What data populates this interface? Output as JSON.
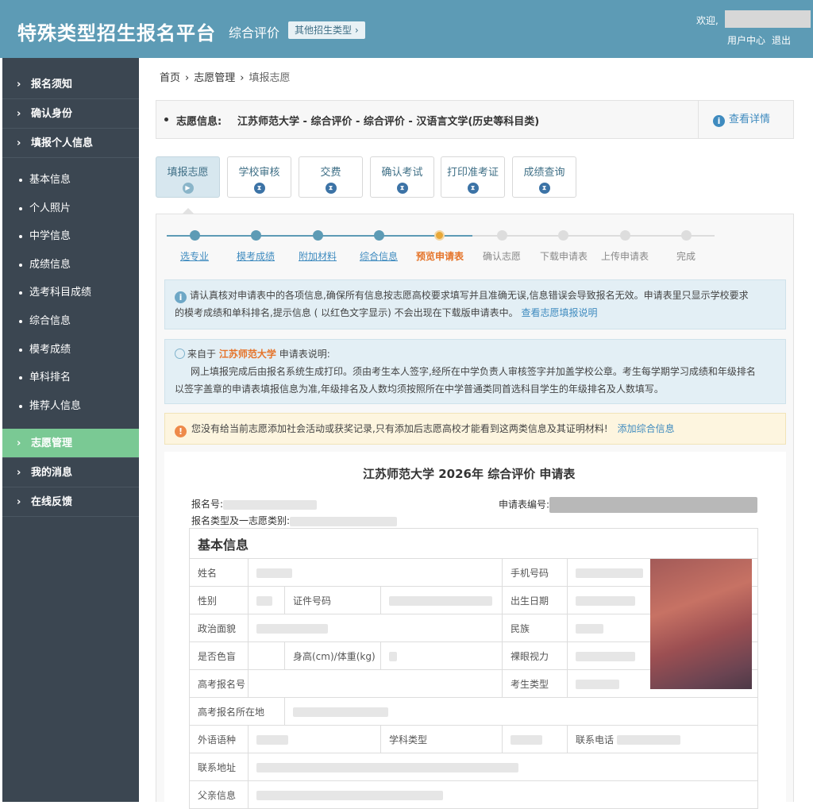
{
  "header": {
    "brand": "特殊类型招生报名平台",
    "sub_brand": "综合评价",
    "other_type_button": "其他招生类型 ›",
    "welcome": "欢迎,",
    "user_center": "用户中心",
    "logout": "退出"
  },
  "sidebar": {
    "items": [
      {
        "label": "报名须知"
      },
      {
        "label": "确认身份"
      },
      {
        "label": "填报个人信息"
      }
    ],
    "sub_items": [
      {
        "label": "基本信息"
      },
      {
        "label": "个人照片"
      },
      {
        "label": "中学信息"
      },
      {
        "label": "成绩信息"
      },
      {
        "label": "选考科目成绩"
      },
      {
        "label": "综合信息"
      },
      {
        "label": "模考成绩"
      },
      {
        "label": "单科排名"
      },
      {
        "label": "推荐人信息"
      }
    ],
    "bottom_items": [
      {
        "label": "志愿管理"
      },
      {
        "label": "我的消息"
      },
      {
        "label": "在线反馈"
      }
    ]
  },
  "breadcrumb": {
    "home": "首页",
    "manage": "志愿管理",
    "current": "填报志愿"
  },
  "volunteer": {
    "label": "志愿信息:",
    "value": "江苏师范大学 - 综合评价 - 综合评价 - 汉语言文学(历史等科目类)",
    "detail": "查看详情"
  },
  "step_tabs": [
    {
      "label": "填报志愿"
    },
    {
      "label": "学校审核"
    },
    {
      "label": "交费"
    },
    {
      "label": "确认考试"
    },
    {
      "label": "打印准考证"
    },
    {
      "label": "成绩查询"
    }
  ],
  "progress": [
    {
      "label": "选专业"
    },
    {
      "label": "模考成绩"
    },
    {
      "label": "附加材料"
    },
    {
      "label": "综合信息"
    },
    {
      "label": "预览申请表"
    },
    {
      "label": "确认志愿"
    },
    {
      "label": "下载申请表"
    },
    {
      "label": "上传申请表"
    },
    {
      "label": "完成"
    }
  ],
  "notices": {
    "n1_line1": "请认真核对申请表中的各项信息,确保所有信息按志愿高校要求填写并且准确无误,信息错误会导致报名无效。申请表里只显示学校要求",
    "n1_line2": "的模考成绩和单科排名,提示信息 ( 以红色文字显示) 不会出现在下载版申请表中。",
    "n1_link": "查看志愿填报说明",
    "n2_prefix": "来自于",
    "n2_school": "江苏师范大学",
    "n2_suffix": "申请表说明:",
    "n2_line1": "网上填报完成后由报名系统生成打印。须由考生本人签字,经所在中学负责人审核签字并加盖学校公章。考生每学期学习成绩和年级排名",
    "n2_line2": "以签字盖章的申请表填报信息为准,年级排名及人数均须按照所在中学普通类同首选科目学生的年级排名及人数填写。",
    "n3_text": "您没有给当前志愿添加社会活动或获奖记录,只有添加后志愿高校才能看到这两类信息及其证明材料!",
    "n3_link": "添加综合信息"
  },
  "form": {
    "title": "江苏师范大学 2026年 综合评价 申请表",
    "reg_no_label": "报名号:",
    "app_no_label": "申请表编号:",
    "type_label": "报名类型及一志愿类别:",
    "section": "基本信息",
    "fields": {
      "name": "姓名",
      "phone": "手机号码",
      "gender": "性别",
      "id_no": "证件号码",
      "birth": "出生日期",
      "politics": "政治面貌",
      "ethnicity": "民族",
      "color_blind": "是否色盲",
      "height_weight": "身高(cm)/体重(kg)",
      "vision": "裸眼视力",
      "gaokao_no": "高考报名号",
      "student_type": "考生类型",
      "gaokao_place": "高考报名所在地",
      "language": "外语语种",
      "subject_type": "学科类型",
      "contact_phone": "联系电话",
      "address": "联系地址",
      "father": "父亲信息"
    }
  }
}
